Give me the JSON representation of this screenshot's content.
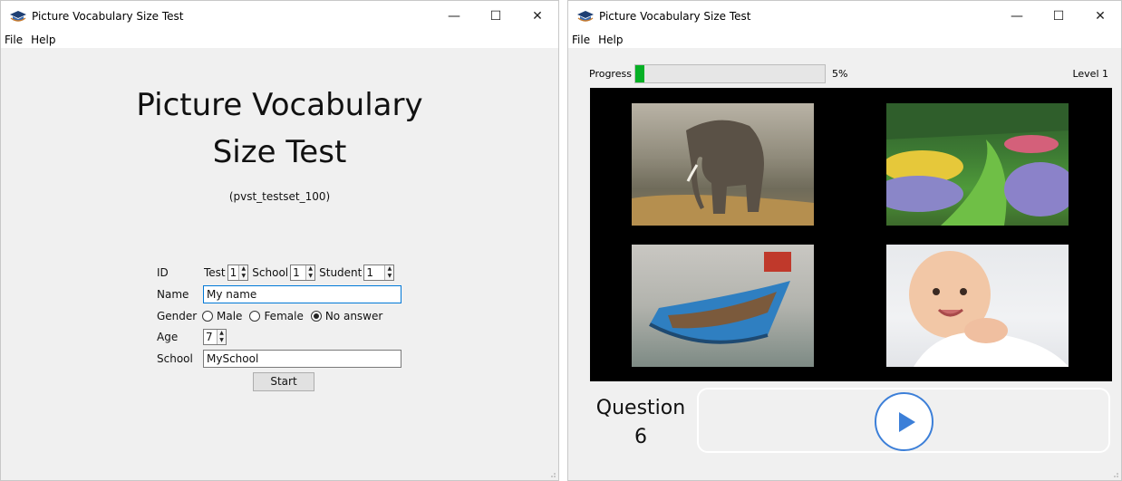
{
  "left_window": {
    "title": "Picture Vocabulary Size Test",
    "menu": [
      "File",
      "Help"
    ],
    "controls": {
      "minimize": "—",
      "maximize": "☐",
      "close": "✕"
    },
    "heading_line1": "Picture Vocabulary",
    "heading_line2": "Size Test",
    "testset": "(pvst_testset_100)",
    "id_label": "ID",
    "test_label": "Test",
    "test_value": "1",
    "school_id_label": "School",
    "school_id_value": "1",
    "student_label": "Student",
    "student_value": "1",
    "name_label": "Name",
    "name_value": "My name",
    "gender_label": "Gender",
    "gender_options": [
      "Male",
      "Female",
      "No answer"
    ],
    "gender_selected": "No answer",
    "age_label": "Age",
    "age_value": "7",
    "school_label": "School",
    "school_value": "MySchool",
    "start_label": "Start"
  },
  "right_window": {
    "title": "Picture Vocabulary Size Test",
    "menu": [
      "File",
      "Help"
    ],
    "controls": {
      "minimize": "—",
      "maximize": "☐",
      "close": "✕"
    },
    "progress_label": "Progress",
    "progress_percent": 5,
    "progress_text": "5%",
    "progress_color": "#06b025",
    "level_text": "Level 1",
    "images": [
      "elephant",
      "garden",
      "boat",
      "baby"
    ],
    "question_word": "Question",
    "question_number": "6",
    "play_icon": "play-icon",
    "accent": "#3c7fd8"
  }
}
